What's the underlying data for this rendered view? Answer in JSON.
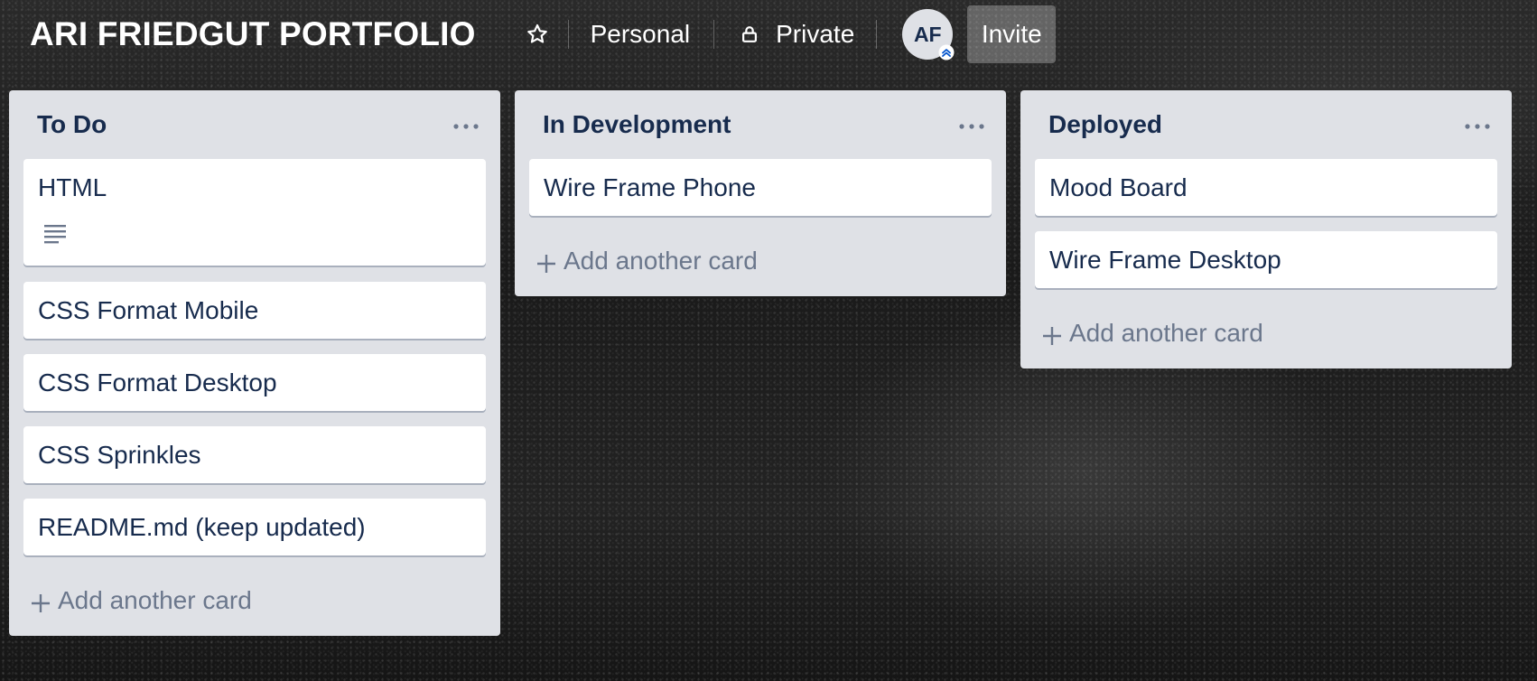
{
  "board": {
    "title": "ARI FRIEDGUT PORTFOLIO",
    "star_icon": "star-outline-icon",
    "team_label": "Personal",
    "visibility_label": "Private",
    "visibility_icon": "lock-icon",
    "member_initials": "AF",
    "invite_label": "Invite"
  },
  "lists": [
    {
      "title": "To Do",
      "cards": [
        {
          "title": "HTML",
          "has_description": true
        },
        {
          "title": "CSS Format Mobile"
        },
        {
          "title": "CSS Format Desktop"
        },
        {
          "title": "CSS Sprinkles"
        },
        {
          "title": "README.md (keep updated)"
        }
      ],
      "add_card_label": "Add another card"
    },
    {
      "title": "In Development",
      "cards": [
        {
          "title": "Wire Frame Phone"
        }
      ],
      "add_card_label": "Add another card"
    },
    {
      "title": "Deployed",
      "cards": [
        {
          "title": "Mood Board"
        },
        {
          "title": "Wire Frame Desktop"
        }
      ],
      "add_card_label": "Add another card"
    }
  ],
  "colors": {
    "list_bg": "#dfe1e6",
    "card_bg": "#ffffff",
    "text_primary": "#172b4d",
    "text_muted": "#6b778c"
  }
}
